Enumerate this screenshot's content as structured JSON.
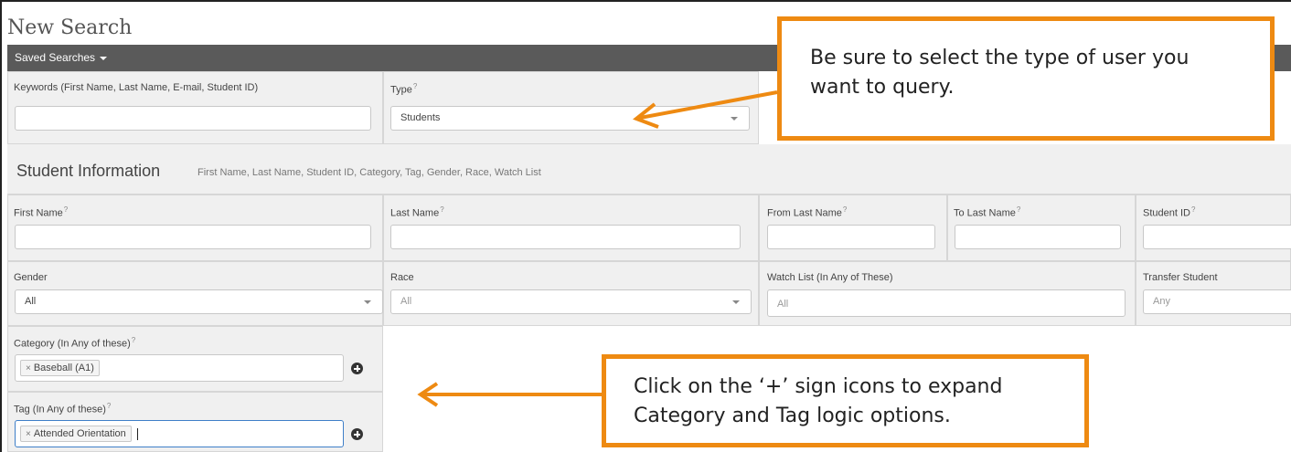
{
  "page": {
    "title": "New Search"
  },
  "toolbar": {
    "saved_searches_label": "Saved Searches"
  },
  "search": {
    "keywords_label": "Keywords (First Name, Last Name, E-mail, Student ID)",
    "keywords_value": "",
    "type_label": "Type",
    "type_value": "Students",
    "help_mark": "?"
  },
  "section": {
    "title": "Student Information",
    "subtitle": "First Name, Last Name, Student ID, Category, Tag, Gender, Race, Watch List"
  },
  "fields": {
    "first_name_label": "First Name",
    "last_name_label": "Last Name",
    "from_last_name_label": "From Last Name",
    "to_last_name_label": "To Last Name",
    "student_id_label": "Student ID",
    "gender_label": "Gender",
    "gender_value": "All",
    "race_label": "Race",
    "race_value": "All",
    "watch_list_label": "Watch List (In Any of These)",
    "watch_list_value": "All",
    "transfer_label": "Transfer Student",
    "transfer_value": "Any",
    "category_label": "Category (In Any of these)",
    "category_chip": "Baseball (A1)",
    "tag_label": "Tag (In Any of these)",
    "tag_chip": "Attended Orientation",
    "chip_remove": "×"
  },
  "callouts": {
    "type_note": "Be sure to select the type of user you want to query.",
    "plus_note": "Click on the ‘+’ sign icons to expand Category and Tag logic options."
  },
  "colors": {
    "callout_border": "#ee8a12",
    "toolbar_bg": "#5a5a5a",
    "panel_bg": "#f0f0f0",
    "focus_border": "#3f7fc8"
  },
  "icons": [
    "caret-down-icon",
    "plus-circle-icon",
    "remove-chip-icon",
    "arrow-icon"
  ]
}
